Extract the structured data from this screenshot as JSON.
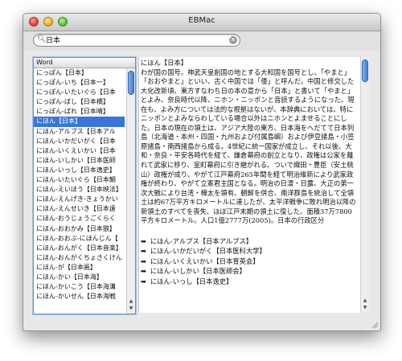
{
  "window": {
    "title": "EBMac"
  },
  "search": {
    "value": "日本",
    "placeholder": ""
  },
  "list": {
    "header": "Word",
    "items": [
      "にっぽん【日本】",
      "にっぽん‐いち【日本一】",
      "にっぽん‐いたいぐら【日本",
      "にっぽん‐ばし【日本橋】",
      "にっぽん‐ばれ【日本晴】",
      "にほん【日本】",
      "にほん‐アルプス【日本アル",
      "にほん‐いかだいがく【日本",
      "にほん‐いくえいかい【日本",
      "にほん‐いしかい【日本医師",
      "にほん‐いっし【日本逸史】",
      "にほん‐いたいぐら【日本鯛",
      "にほん‐えいほう【日本映法】",
      "にほん‐えんげき‐きょうかい",
      "にほん‐えんせいき【日本遠",
      "にほん‐おうじょうごくらく",
      "にほん‐おおかみ【日本狼】",
      "にほん‐おおぶ‐にほんじん【",
      "にほん‐おんがく【日本音楽】",
      "にほん‐おんがくちょさくけん",
      "にほん‐が【日本画】",
      "にほん‐かい【日本海】",
      "にほん‐かいこう【日本海溝",
      "にほん‐かいせん【日本海戦"
    ],
    "selected_index": 5
  },
  "definition": {
    "heading": "にほん【日本】",
    "paragraphs": [
      "わが国の国号。神武天皇創国の地とする大和国を国号とし、「やまと」「おおやまと」といい、古く中国では「倭」と呼んだ。中国と修交した大化改新頃、東方すなわち日の本の意から「日本」と書いて「やまと」とよみ、奈良時代以降、ニホン・ニッポンと音読するようになった。現在も、よみ方については法的な根拠はないが、本辞典においては、特にニッポンとよみならわしている場合以外はニホンとよませることにした。日本の現在の領土は、アジア大陸の東方、日本海をへだてて日本列島（北海道・本州・四国・九州および付属島嶼）および伊豆諸島・小笠原諸島・南西諸島から成る。4世紀に統一国家が成立し、それ以後、大和・奈良・平安各時代を経て、鎌倉幕府の創立となり、政権は公家を離れて武家に移り、室町幕府に引き継がれる。ついで織田・豊臣（安土桃山）政権が成り、やがて江戸幕府265年間を経て明治維新により武家政権が終わり、やがて立憲君主国となる。明治の日清・日露、大正の第一次大戦により台湾・樺太を領有、朝鮮を併合、南洋群島を統治して全領土は約67万平方キロメートルに達したが、太平洋戦争に敗れ明治以降の新領土のすべてを喪失、ほぼ江戸末期の領土に復した。面積37万7800平方キロメートル。人口1億2777万(2005)。日本の行政区分"
    ],
    "links": [
      "にほん‐アルプス【日本アルプス】",
      "にほん‐いかだいがく【日本医科大学】",
      "にほん‐いくえいかい【日本育英会】",
      "にほん‐いしかい【日本医師会】",
      "にほん‐いっし【日本逸史】"
    ],
    "link_icon": "arrow-right-icon"
  }
}
